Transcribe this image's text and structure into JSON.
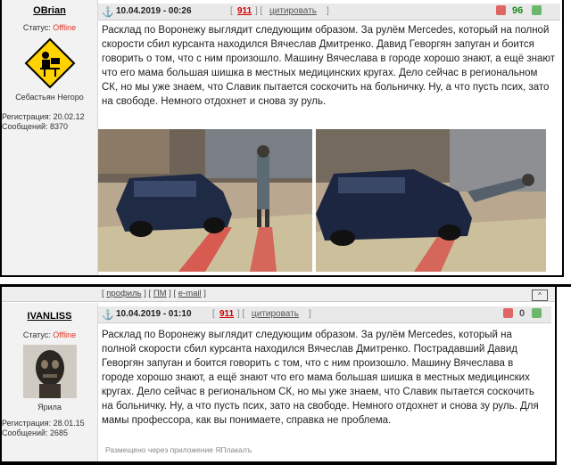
{
  "post1": {
    "username": "OBrian",
    "status_label": "Статус:",
    "status_value": "Offline",
    "avatar_caption": "Себастьян Негоро",
    "reg_label": "Регистрация:",
    "reg_value": "20.02.12",
    "msgs_label": "Сообщений:",
    "msgs_value": "8370",
    "date": "10.04.2019 - 00:26",
    "post_number": "911",
    "quote_label": "цитировать",
    "rating": "96",
    "body": "Расклад по Воронежу выглядит следующим образом. За рулём Mercedes, который на полной скорости сбил курсанта находился Вячеслав Дмитренко. Давид Геворгян запуган и боится говорить о том, что с ним произошло. Машину Вячеслава в городе хорошо знают, а ещё знают что его мама большая шишка в местных медицинских кругах. Дело сейчас в региональном СК, но мы уже знаем, что Славик пытается соскочить на больничку. Ну, а что пусть псих, зато на свободе. Немного отдохнет и снова зу руль."
  },
  "profile_links": {
    "profile": "профиль",
    "pm": "ПМ",
    "email": "e-mail",
    "up": "^"
  },
  "post2": {
    "username": "IVANLISS",
    "status_label": "Статус:",
    "status_value": "Offline",
    "avatar_caption": "Ярила",
    "reg_label": "Регистрация:",
    "reg_value": "28.01.15",
    "msgs_label": "Сообщений:",
    "msgs_value": "2685",
    "date": "10.04.2019 - 01:10",
    "post_number": "911",
    "quote_label": "цитировать",
    "rating": "0",
    "body": "Расклад по Воронежу выглядит следующим образом. За рулём Mercedes, который на полной скорости сбил курсанта находился Вячеслав Дмитренко. Пострадавший Давид Геворгян запуган и боится говорить с том, что с ним произошло. Машину Вячеслава в городе хорошо знают, а ещё знают что его мама большая шишка в местных медицинских кругах. Дело сейчас в региональном СК, но мы уже знаем, что Славик пытается соскочить на больничку. Ну, а что пусть псих, зато на свободе. Немного отдохнет и снова зу руль. Для мамы профессора, как вы понимаете, справка не проблема.",
    "footnote": "Размещено через приложение  ЯПлакалъ"
  },
  "colors": {
    "offline": "#d32222",
    "post_number": "#cc0000",
    "rating_positive": "#1e8b1e"
  }
}
